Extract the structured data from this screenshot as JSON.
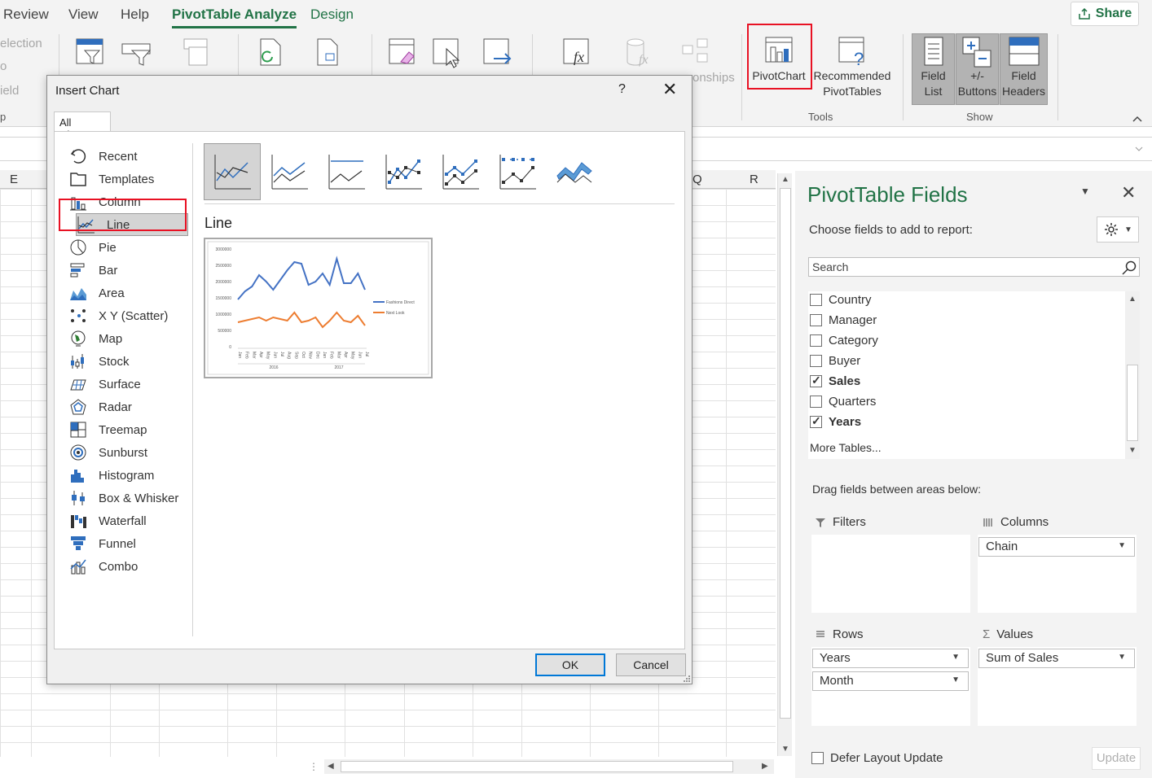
{
  "ribbon": {
    "tabs": [
      "Review",
      "View",
      "Help",
      "PivotTable Analyze",
      "Design"
    ],
    "active_tab": "PivotTable Analyze",
    "share_label": "Share",
    "left_cut_labels": [
      "election",
      "o",
      "ield",
      "p"
    ],
    "pivotchart_label": "PivotChart",
    "recommended_label_1": "Recommended",
    "recommended_label_2": "PivotTables",
    "cut_label": "onships",
    "tools_group_label": "Tools",
    "show_group_label": "Show",
    "field_list_1": "Field",
    "field_list_2": "List",
    "buttons_1": "+/-",
    "buttons_2": "Buttons",
    "headers_1": "Field",
    "headers_2": "Headers"
  },
  "sheet": {
    "col_e": "E",
    "col_q": "Q",
    "col_r": "R"
  },
  "dialog": {
    "title": "Insert Chart",
    "help": "?",
    "tab": "All Charts",
    "chart_types": [
      {
        "label": "Recent",
        "icon": "recent-icon"
      },
      {
        "label": "Templates",
        "icon": "templates-icon"
      },
      {
        "label": "Column",
        "icon": "column-chart-icon"
      },
      {
        "label": "Line",
        "icon": "line-chart-icon"
      },
      {
        "label": "Pie",
        "icon": "pie-chart-icon"
      },
      {
        "label": "Bar",
        "icon": "bar-chart-icon"
      },
      {
        "label": "Area",
        "icon": "area-chart-icon"
      },
      {
        "label": "X Y (Scatter)",
        "icon": "scatter-chart-icon"
      },
      {
        "label": "Map",
        "icon": "map-chart-icon"
      },
      {
        "label": "Stock",
        "icon": "stock-chart-icon"
      },
      {
        "label": "Surface",
        "icon": "surface-chart-icon"
      },
      {
        "label": "Radar",
        "icon": "radar-chart-icon"
      },
      {
        "label": "Treemap",
        "icon": "treemap-chart-icon"
      },
      {
        "label": "Sunburst",
        "icon": "sunburst-chart-icon"
      },
      {
        "label": "Histogram",
        "icon": "histogram-chart-icon"
      },
      {
        "label": "Box & Whisker",
        "icon": "box-whisker-chart-icon"
      },
      {
        "label": "Waterfall",
        "icon": "waterfall-chart-icon"
      },
      {
        "label": "Funnel",
        "icon": "funnel-chart-icon"
      },
      {
        "label": "Combo",
        "icon": "combo-chart-icon"
      }
    ],
    "selected_type": "Line",
    "subtype_title": "Line",
    "ok_label": "OK",
    "cancel_label": "Cancel",
    "preview": {
      "y_ticks": [
        "3000000",
        "2500000",
        "2000000",
        "1500000",
        "1000000",
        "500000",
        "0"
      ],
      "months": [
        "Jan",
        "Feb",
        "Mar",
        "Apr",
        "May",
        "Jun",
        "Jul",
        "Aug",
        "Sep",
        "Oct",
        "Nov",
        "Dec",
        "Jan",
        "Feb",
        "Mar",
        "Apr",
        "May",
        "Jun",
        "Jul"
      ],
      "years": [
        "2016",
        "2017"
      ],
      "series": [
        {
          "name": "Fashions Direct",
          "color": "#4472c4"
        },
        {
          "name": "Next Look",
          "color": "#ed7d31"
        }
      ]
    }
  },
  "pivot_fields": {
    "title": "PivotTable Fields",
    "subtitle": "Choose fields to add to report:",
    "search_placeholder": "Search",
    "fields": [
      {
        "label": "Country",
        "checked": false
      },
      {
        "label": "Manager",
        "checked": false
      },
      {
        "label": "Category",
        "checked": false
      },
      {
        "label": "Buyer",
        "checked": false
      },
      {
        "label": "Sales",
        "checked": true
      },
      {
        "label": "Quarters",
        "checked": false
      },
      {
        "label": "Years",
        "checked": true
      }
    ],
    "more_tables": "More Tables...",
    "drag_label": "Drag fields between areas below:",
    "filters_label": "Filters",
    "columns_label": "Columns",
    "rows_label": "Rows",
    "values_label": "Values",
    "columns_items": [
      "Chain"
    ],
    "rows_items": [
      "Years",
      "Month"
    ],
    "values_items": [
      "Sum of Sales"
    ],
    "defer_label": "Defer Layout Update",
    "update_label": "Update"
  }
}
